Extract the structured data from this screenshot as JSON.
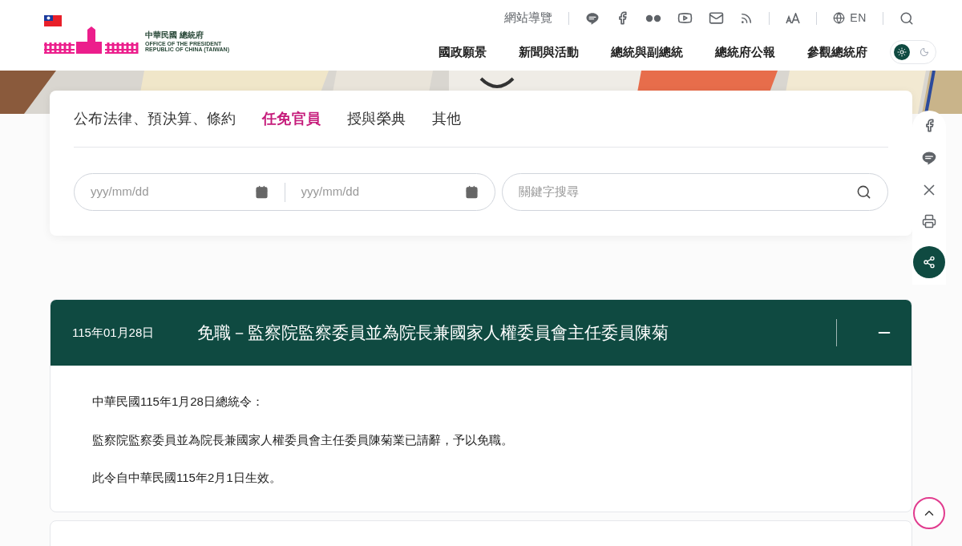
{
  "header": {
    "logo": {
      "name_zh": "中華民國 總統府",
      "name_en": "OFFICE OF THE PRESIDENT",
      "name_en_2": "REPUBLIC OF CHINA (TAIWAN)"
    },
    "sitemap": "網站導覽",
    "language": "EN",
    "main_nav": [
      {
        "label": "國政願景"
      },
      {
        "label": "新聞與活動"
      },
      {
        "label": "總統與副總統"
      },
      {
        "label": "總統府公報"
      },
      {
        "label": "參觀總統府"
      }
    ],
    "dark_mode": false
  },
  "tabs": [
    {
      "label": "公布法律、預決算、條約",
      "selected": false
    },
    {
      "label": "任免官員",
      "selected": true
    },
    {
      "label": "授與榮典",
      "selected": false
    },
    {
      "label": "其他",
      "selected": false
    }
  ],
  "filters": {
    "start_date": {
      "placeholder": "yyy/mm/dd"
    },
    "end_date": {
      "placeholder": "yyy/mm/dd"
    },
    "search": {
      "placeholder": "關鍵字搜尋"
    }
  },
  "entries": [
    {
      "date": "115年01月28日",
      "title": "免職－監察院監察委員並為院長兼國家人權委員會主任委員陳菊",
      "expanded": true,
      "paragraphs": [
        "中華民國115年1月28日總統令：",
        "監察院監察委員並為院長兼國家人權委員會主任委員陳菊業已請辭，予以免職。",
        "此令自中華民國115年2月1日生效。"
      ]
    },
    {
      "expanded": false
    }
  ]
}
